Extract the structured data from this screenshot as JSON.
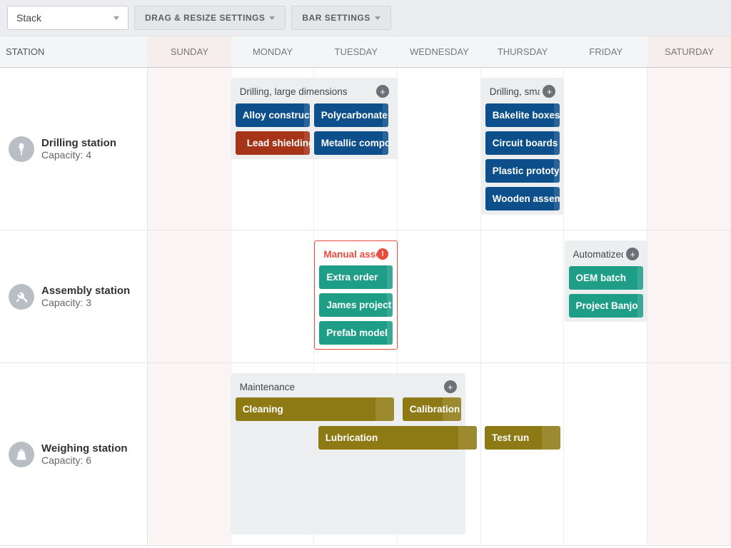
{
  "toolbar": {
    "select_value": "Stack",
    "drag_resize": "DRAG & RESIZE SETTINGS",
    "bar_settings": "BAR SETTINGS"
  },
  "header": {
    "station": "STATION",
    "days": [
      "SUNDAY",
      "MONDAY",
      "TUESDAY",
      "WEDNESDAY",
      "THURSDAY",
      "FRIDAY",
      "SATURDAY"
    ]
  },
  "stations": {
    "drilling": {
      "name": "Drilling station",
      "capacity": "Capacity: 4"
    },
    "assembly": {
      "name": "Assembly station",
      "capacity": "Capacity: 3"
    },
    "weighing": {
      "name": "Weighing station",
      "capacity": "Capacity: 6"
    }
  },
  "groups": {
    "drill_large": {
      "title": "Drilling, large dimensions",
      "items": [
        "Alloy construction",
        "Polycarbonate housing",
        "Lead shielding",
        "Metallic compound"
      ]
    },
    "drill_small": {
      "title": "Drilling, small dimensions",
      "items": [
        "Bakelite boxes",
        "Circuit boards",
        "Plastic prototypes",
        "Wooden assembly"
      ]
    },
    "manual_asm": {
      "title": "Manual assembly",
      "items": [
        "Extra order",
        "James project",
        "Prefab model"
      ]
    },
    "auto_asm": {
      "title": "Automatized assembly",
      "items": [
        "OEM batch",
        "Project Banjo"
      ]
    },
    "maint": {
      "title": "Maintenance",
      "bars": [
        "Cleaning",
        "Calibration",
        "Lubrication",
        "Test run"
      ]
    }
  }
}
